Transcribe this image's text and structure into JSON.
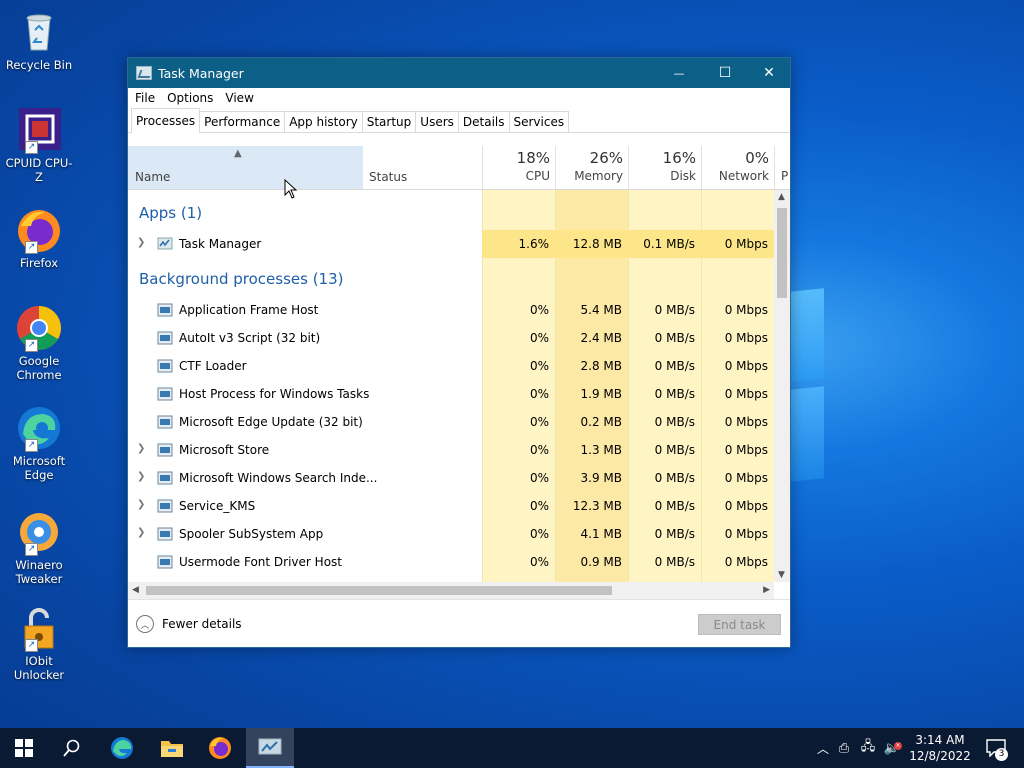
{
  "desktop": {
    "icons": [
      {
        "label": "Recycle Bin"
      },
      {
        "label": "CPUID CPU-Z"
      },
      {
        "label": "Firefox"
      },
      {
        "label": "Google Chrome"
      },
      {
        "label": "Microsoft Edge"
      },
      {
        "label": "Winaero Tweaker"
      },
      {
        "label": "IObit Unlocker"
      }
    ]
  },
  "window": {
    "title": "Task Manager",
    "controls": {
      "minimize": "—",
      "maximize": "☐",
      "close": "✕"
    },
    "menu": [
      "File",
      "Options",
      "View"
    ],
    "tabs": [
      "Processes",
      "Performance",
      "App history",
      "Startup",
      "Users",
      "Details",
      "Services"
    ],
    "active_tab": "Processes",
    "columns": {
      "name": "Name",
      "status": "Status",
      "cpu": {
        "pct": "18%",
        "label": "CPU"
      },
      "memory": {
        "pct": "26%",
        "label": "Memory"
      },
      "disk": {
        "pct": "16%",
        "label": "Disk"
      },
      "network": {
        "pct": "0%",
        "label": "Network"
      },
      "power_partial": "P"
    },
    "groups": {
      "apps": "Apps (1)",
      "background": "Background processes (13)"
    },
    "apps": [
      {
        "name": "Task Manager",
        "cpu": "1.6%",
        "memory": "12.8 MB",
        "disk": "0.1 MB/s",
        "network": "0 Mbps",
        "expandable": true
      }
    ],
    "background": [
      {
        "name": "Application Frame Host",
        "cpu": "0%",
        "memory": "5.4 MB",
        "disk": "0 MB/s",
        "network": "0 Mbps",
        "expandable": false
      },
      {
        "name": "AutoIt v3 Script (32 bit)",
        "cpu": "0%",
        "memory": "2.4 MB",
        "disk": "0 MB/s",
        "network": "0 Mbps",
        "expandable": false
      },
      {
        "name": "CTF Loader",
        "cpu": "0%",
        "memory": "2.8 MB",
        "disk": "0 MB/s",
        "network": "0 Mbps",
        "expandable": false
      },
      {
        "name": "Host Process for Windows Tasks",
        "cpu": "0%",
        "memory": "1.9 MB",
        "disk": "0 MB/s",
        "network": "0 Mbps",
        "expandable": false
      },
      {
        "name": "Microsoft Edge Update (32 bit)",
        "cpu": "0%",
        "memory": "0.2 MB",
        "disk": "0 MB/s",
        "network": "0 Mbps",
        "expandable": false
      },
      {
        "name": "Microsoft Store",
        "cpu": "0%",
        "memory": "1.3 MB",
        "disk": "0 MB/s",
        "network": "0 Mbps",
        "expandable": true
      },
      {
        "name": "Microsoft Windows Search Inde...",
        "cpu": "0%",
        "memory": "3.9 MB",
        "disk": "0 MB/s",
        "network": "0 Mbps",
        "expandable": true
      },
      {
        "name": "Service_KMS",
        "cpu": "0%",
        "memory": "12.3 MB",
        "disk": "0 MB/s",
        "network": "0 Mbps",
        "expandable": true
      },
      {
        "name": "Spooler SubSystem App",
        "cpu": "0%",
        "memory": "4.1 MB",
        "disk": "0 MB/s",
        "network": "0 Mbps",
        "expandable": true
      },
      {
        "name": "Usermode Font Driver Host",
        "cpu": "0%",
        "memory": "0.9 MB",
        "disk": "0 MB/s",
        "network": "0 Mbps",
        "expandable": false
      }
    ],
    "footer": {
      "fewer_details": "Fewer details",
      "end_task": "End task"
    }
  },
  "taskbar": {
    "clock_time": "3:14 AM",
    "clock_date": "12/8/2022",
    "notification_count": "3"
  },
  "colors": {
    "title_bar": "#0c5f86",
    "cpu_highlight": "#fff4c4",
    "group_text": "#1f5fa8"
  }
}
